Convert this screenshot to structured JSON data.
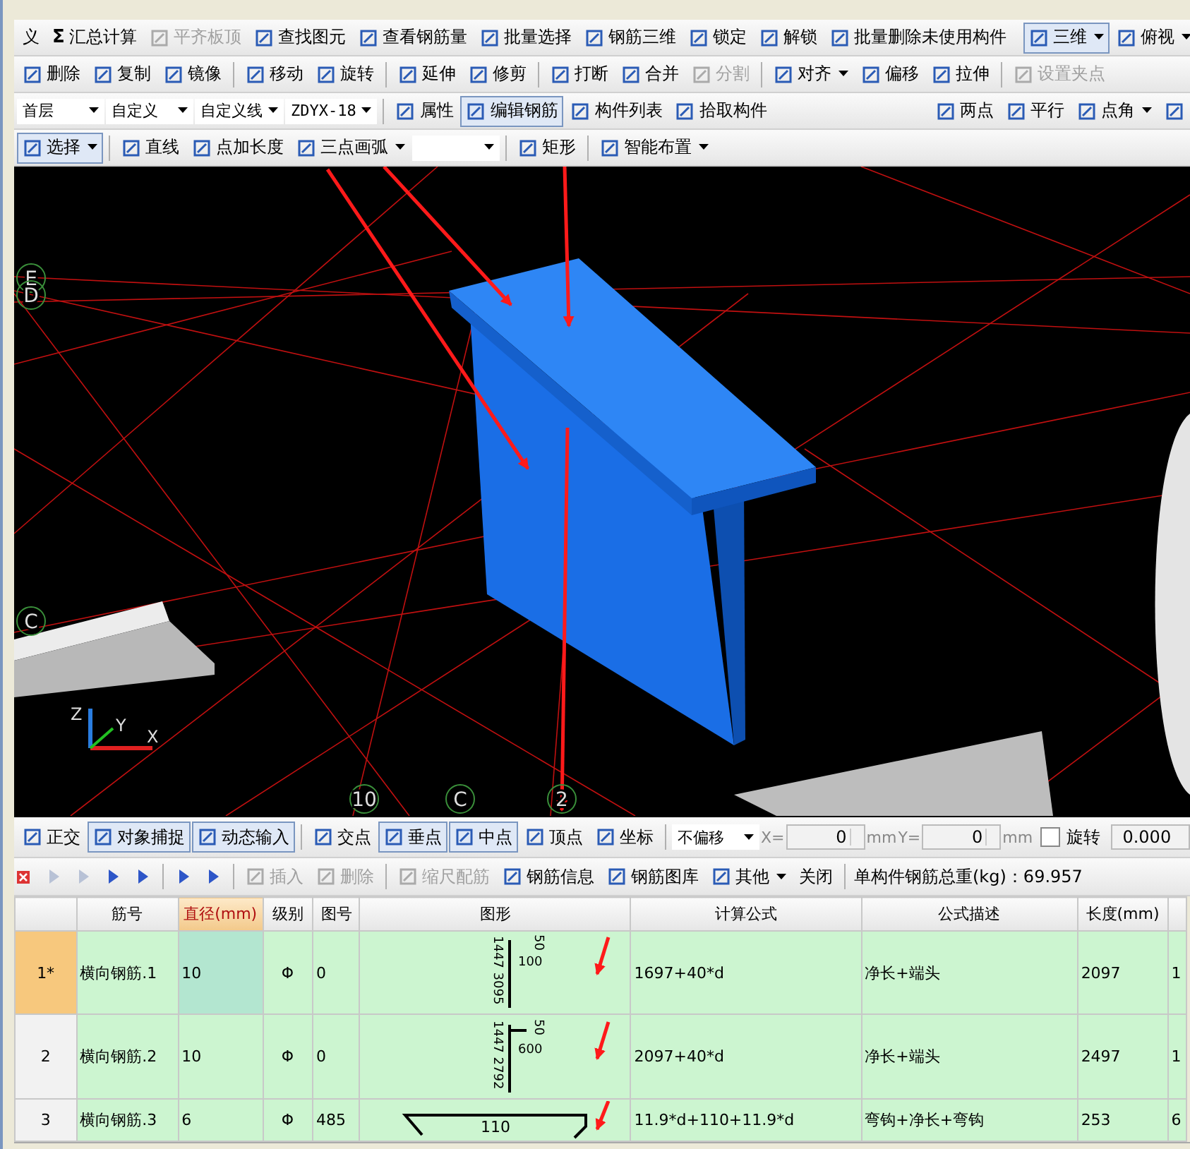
{
  "toolbar_rows": [
    [
      {
        "kind": "button",
        "label": "义",
        "icon": false
      },
      {
        "kind": "button",
        "label": "汇总计算",
        "glyph": "Σ"
      },
      {
        "kind": "button",
        "label": "平齐板顶",
        "disabled": true
      },
      {
        "kind": "button",
        "label": "查找图元"
      },
      {
        "kind": "button",
        "label": "查看钢筋量"
      },
      {
        "kind": "button",
        "label": "批量选择"
      },
      {
        "kind": "button",
        "label": "钢筋三维"
      },
      {
        "kind": "button",
        "label": "锁定"
      },
      {
        "kind": "button",
        "label": "解锁"
      },
      {
        "kind": "button",
        "label": "批量删除未使用构件"
      },
      {
        "kind": "sep"
      },
      {
        "kind": "button",
        "label": "三维",
        "dropdown": true,
        "selected": true
      },
      {
        "kind": "button",
        "label": "俯视",
        "dropdown": true,
        "selected": false
      }
    ],
    [
      {
        "kind": "button",
        "label": "删除"
      },
      {
        "kind": "button",
        "label": "复制"
      },
      {
        "kind": "button",
        "label": "镜像"
      },
      {
        "kind": "sep"
      },
      {
        "kind": "button",
        "label": "移动"
      },
      {
        "kind": "button",
        "label": "旋转"
      },
      {
        "kind": "sep"
      },
      {
        "kind": "button",
        "label": "延伸"
      },
      {
        "kind": "button",
        "label": "修剪"
      },
      {
        "kind": "sep"
      },
      {
        "kind": "button",
        "label": "打断"
      },
      {
        "kind": "button",
        "label": "合并"
      },
      {
        "kind": "button",
        "label": "分割",
        "disabled": true
      },
      {
        "kind": "sep"
      },
      {
        "kind": "button",
        "label": "对齐",
        "dropdown": true
      },
      {
        "kind": "button",
        "label": "偏移"
      },
      {
        "kind": "button",
        "label": "拉伸"
      },
      {
        "kind": "sep"
      },
      {
        "kind": "button",
        "label": "设置夹点",
        "disabled": true
      }
    ],
    [
      {
        "kind": "combo",
        "value": "首层"
      },
      {
        "kind": "combo",
        "value": "自定义"
      },
      {
        "kind": "combo",
        "value": "自定义线"
      },
      {
        "kind": "combo",
        "value": "ZDYX-18"
      },
      {
        "kind": "sep"
      },
      {
        "kind": "button",
        "label": "属性"
      },
      {
        "kind": "button",
        "label": "编辑钢筋",
        "selected": true
      },
      {
        "kind": "button",
        "label": "构件列表"
      },
      {
        "kind": "button",
        "label": "拾取构件"
      },
      {
        "kind": "spacer"
      },
      {
        "kind": "button",
        "label": "两点"
      },
      {
        "kind": "button",
        "label": "平行"
      },
      {
        "kind": "button",
        "label": "点角",
        "dropdown": true
      },
      {
        "kind": "button"
      }
    ],
    [
      {
        "kind": "button",
        "label": "选择",
        "dropdown": true,
        "selected": true
      },
      {
        "kind": "sep"
      },
      {
        "kind": "button",
        "label": "直线"
      },
      {
        "kind": "button",
        "label": "点加长度"
      },
      {
        "kind": "button",
        "label": "三点画弧",
        "dropdown": true
      },
      {
        "kind": "combo"
      },
      {
        "kind": "sep"
      },
      {
        "kind": "button",
        "label": "矩形"
      },
      {
        "kind": "sep"
      },
      {
        "kind": "button",
        "label": "智能布置",
        "dropdown": true
      }
    ]
  ],
  "viewport": {
    "grid_labels": [
      {
        "text": "E"
      },
      {
        "text": "D"
      },
      {
        "text": "C"
      },
      {
        "text": "10"
      },
      {
        "text": "C"
      },
      {
        "text": "2"
      }
    ],
    "axis_labels": [
      "Z",
      "Y",
      "X"
    ]
  },
  "snap_bar": [
    {
      "kind": "button",
      "label": "正交"
    },
    {
      "kind": "button",
      "label": "对象捕捉",
      "selected": true
    },
    {
      "kind": "button",
      "label": "动态输入",
      "selected": true
    },
    {
      "kind": "sep"
    },
    {
      "kind": "button",
      "label": "交点"
    },
    {
      "kind": "button",
      "label": "垂点",
      "selected": true
    },
    {
      "kind": "button",
      "label": "中点",
      "selected": true
    },
    {
      "kind": "button",
      "label": "顶点"
    },
    {
      "kind": "button",
      "label": "坐标"
    },
    {
      "kind": "sep"
    },
    {
      "kind": "combo",
      "value": "不偏移"
    },
    {
      "kind": "field",
      "label": "X=",
      "value": "0",
      "unit": "mm"
    },
    {
      "kind": "field",
      "label": "Y=",
      "value": "0",
      "unit": "mm"
    },
    {
      "kind": "check",
      "label": "旋转",
      "checked": false
    },
    {
      "kind": "field",
      "value": "0.000"
    }
  ],
  "rebar_toolbar": [
    {
      "kind": "nav",
      "disabled": true
    },
    {
      "kind": "nav",
      "disabled": true
    },
    {
      "kind": "nav",
      "disabled": false
    },
    {
      "kind": "nav",
      "disabled": false
    },
    {
      "kind": "sep"
    },
    {
      "kind": "nav",
      "disabled": false
    },
    {
      "kind": "nav",
      "disabled": false
    },
    {
      "kind": "sep"
    },
    {
      "kind": "button",
      "label": "插入",
      "disabled": true
    },
    {
      "kind": "button",
      "label": "删除",
      "disabled": true
    },
    {
      "kind": "sep"
    },
    {
      "kind": "button",
      "label": "缩尺配筋",
      "disabled": true
    },
    {
      "kind": "button",
      "label": "钢筋信息"
    },
    {
      "kind": "button",
      "label": "钢筋图库"
    },
    {
      "kind": "button",
      "label": "其他",
      "dropdown": true
    },
    {
      "kind": "button",
      "label": "关闭",
      "icon": false
    },
    {
      "kind": "sep"
    },
    {
      "kind": "text",
      "label": "单构件钢筋总重(kg)：69.957"
    }
  ],
  "table": {
    "columns": [
      "筋号",
      "直径(mm)",
      "级别",
      "图号",
      "图形",
      "计算公式",
      "公式描述",
      "长度(mm)"
    ],
    "rows": [
      {
        "row_header": "1*",
        "selected": true,
        "cells": [
          "横向钢筋.1",
          "10",
          "Φ",
          "0",
          null,
          "1697+40*d",
          "净长+端头",
          "2097",
          "1"
        ],
        "shape": {
          "kind": "hook",
          "labels": [
            "1447 3095",
            "50",
            "100"
          ]
        }
      },
      {
        "row_header": "2",
        "selected": false,
        "cells": [
          "横向钢筋.2",
          "10",
          "Φ",
          "0",
          null,
          "2097+40*d",
          "净长+端头",
          "2497",
          "1"
        ],
        "shape": {
          "kind": "hook",
          "labels": [
            "1447 2792",
            "50",
            "600"
          ]
        }
      },
      {
        "row_header": "3",
        "selected": false,
        "cells": [
          "横向钢筋.3",
          "6",
          "Φ",
          "485",
          null,
          "11.9*d+110+11.9*d",
          "弯钩+净长+弯钩",
          "253",
          "6"
        ],
        "shape": {
          "kind": "stirrup",
          "labels": [
            "110"
          ]
        }
      }
    ]
  }
}
